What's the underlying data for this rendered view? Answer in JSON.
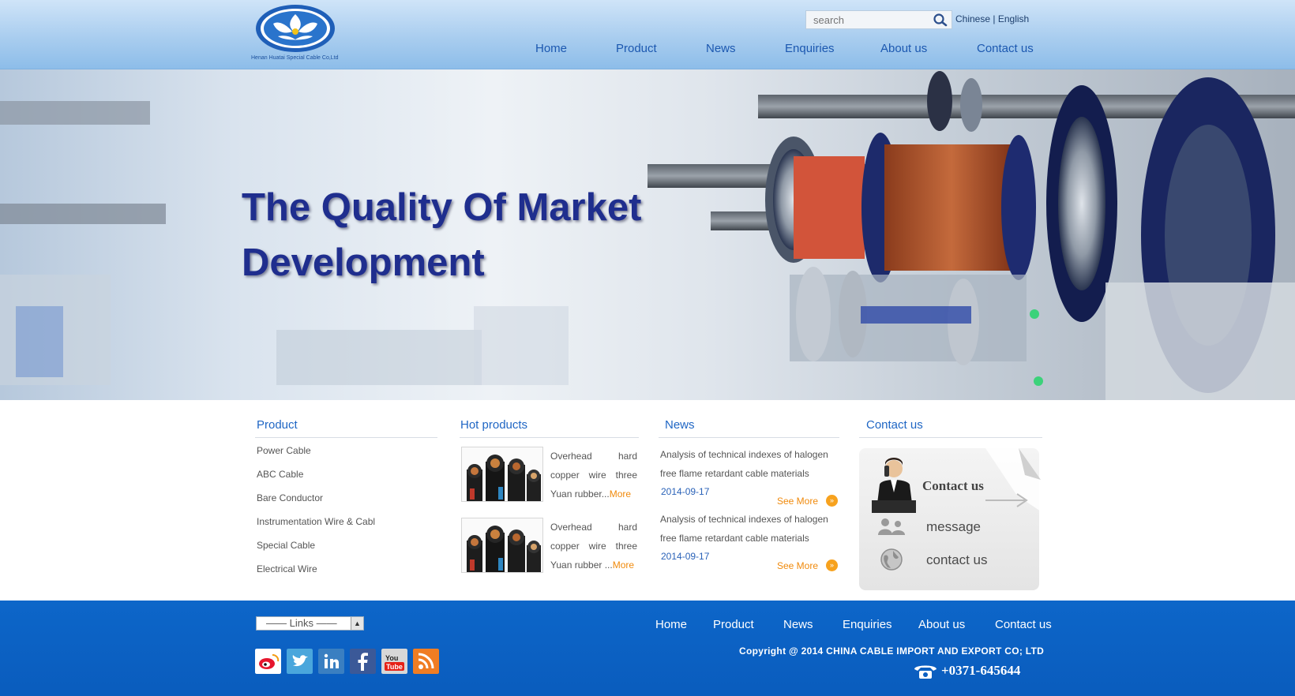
{
  "header": {
    "logo_text": "Henan Huatai Special Cable Co,Ltd",
    "search_placeholder": "search",
    "lang_chinese": "Chinese",
    "lang_sep": "|",
    "lang_english": "English",
    "nav": [
      "Home",
      "Product",
      "News",
      "Enquiries",
      "About us",
      "Contact us"
    ]
  },
  "banner": {
    "line1": "The Quality Of Market",
    "line2": "Development"
  },
  "product": {
    "title": "Product",
    "items": [
      "Power Cable",
      "ABC Cable",
      "Bare Conductor",
      "Instrumentation Wire & Cabl",
      "Special Cable",
      "Electrical Wire"
    ]
  },
  "hot_products": {
    "title": "Hot products",
    "items": [
      {
        "text": "Overhead hard copper wire three Yuan rubber...",
        "more": "More"
      },
      {
        "text": "Overhead hard copper wire three Yuan rubber ...",
        "more": "More"
      }
    ]
  },
  "news": {
    "title": "News",
    "items": [
      {
        "text": "Analysis of technical indexes of halogen free flame retardant cable materials",
        "date": "2014-09-17",
        "more": "See More"
      },
      {
        "text": "Analysis of technical indexes of halogen free flame retardant cable materials",
        "date": "2014-09-17",
        "more": "See More"
      }
    ]
  },
  "contact": {
    "title": "Contact us",
    "panel_heading": "Contact us",
    "message": "message",
    "contact_us": "contact us"
  },
  "footer": {
    "links_label": "Links",
    "nav": [
      "Home",
      "Product",
      "News",
      "Enquiries",
      "About us",
      "Contact us"
    ],
    "copyright": "Copyright @ 2014 CHINA CABLE IMPORT AND EXPORT CO; LTD",
    "phone": "+0371-645644",
    "social_icons": [
      "weibo-icon",
      "twitter-icon",
      "linkedin-icon",
      "facebook-icon",
      "youtube-icon",
      "rss-icon"
    ]
  },
  "colors": {
    "header_blue": "#a9cdef",
    "nav_blue": "#1c58b0",
    "section_title_blue": "#1f66c4",
    "more_orange": "#f08a0c",
    "footer_blue": "#0d66c9",
    "banner_title": "#1f2e8e"
  }
}
